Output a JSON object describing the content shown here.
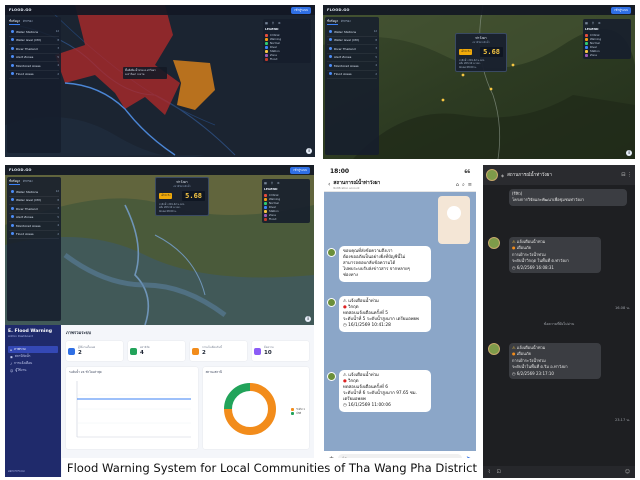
{
  "caption": "Flood Warning System for Local Communities of Tha Wang Pha District",
  "map": {
    "logo": "FLOOD.GO",
    "button": "เข้าสู่ระบบ",
    "tabs": [
      "ชั้นข้อมูล",
      "ตัวกรอง"
    ],
    "layers": [
      {
        "label": "Water Stations",
        "count": "12"
      },
      {
        "label": "Water level (CM)",
        "count": "8"
      },
      {
        "label": "River Thailand",
        "count": "3"
      },
      {
        "label": "Alert Zones",
        "count": "5"
      },
      {
        "label": "Monitored Areas",
        "count": "4"
      },
      {
        "label": "Flood Areas",
        "count": "2"
      }
    ],
    "legend_title": "LEGEND",
    "legend": [
      {
        "label": "Critical",
        "color": "#e74c3c"
      },
      {
        "label": "Warning",
        "color": "#f39c12"
      },
      {
        "label": "Normal",
        "color": "#2ecc71"
      },
      {
        "label": "River",
        "color": "#3b82f6"
      },
      {
        "label": "Station",
        "color": "#f5c542"
      },
      {
        "label": "Zone",
        "color": "#9b59b6"
      },
      {
        "label": "Flood",
        "color": "#c0392b"
      }
    ],
    "map1_popup": "พื้นที่เสี่ยงน้ำท่วม ต.ท่าวังผา อ.ท่าวังผา จ.น่าน",
    "card": {
      "title": "ท่าวังผา",
      "subtitle": "สถานีวัดระดับน้ำ",
      "badge": "เฝ้าระวัง",
      "value": "5.68",
      "lines": [
        "ระดับน้ำ 201.42 ม.รทก.",
        "ตลิ่ง 203.10 ม.รทก.",
        "อัปเดต 08:00 น."
      ]
    }
  },
  "dashboard": {
    "title": "E. Flood Warning",
    "subtitle": "Admin Dashboard",
    "nav": [
      "ภาพรวม",
      "สถานีวัดน้ำ",
      "การแจ้งเตือน",
      "ผู้ใช้งาน"
    ],
    "footer": "ออกจากระบบ",
    "heading": "ภาพรวมระบบ",
    "stats": [
      {
        "label": "ผู้ใช้งานทั้งหมด",
        "value": "2",
        "color": "#2f6fe4"
      },
      {
        "label": "สถานีวัด",
        "value": "4",
        "color": "#22a35a"
      },
      {
        "label": "การแจ้งเตือนวันนี้",
        "value": "2",
        "color": "#f28c1b"
      },
      {
        "label": "ข้อความ",
        "value": "10",
        "color": "#8b5cf6"
      }
    ],
    "line_chart_title": "ระดับน้ำ 24 ชั่วโมงล่าสุด",
    "donut_title": "สถานะสถานี",
    "donut_legend": [
      {
        "label": "ระดับ 1",
        "color": "#f28c1b",
        "value": 3
      },
      {
        "label": "ปกติ",
        "color": "#22a35a",
        "value": 1
      }
    ]
  },
  "chat_light": {
    "time": "18:00",
    "battery": "66",
    "name": "สถานการณ์น้ำท่าวังผา",
    "subname": "Notification account",
    "msg1": [
      "ขอบคุณที่ส่งข้อความถึงเรา",
      "ต้องขออภัยเป็นอย่างยิ่งที่บัญชีนี้ไม่",
      "สามารถตอบกลับข้อความได้",
      "ไปพบระบบรับส่งข่าวสาร จากหลายๆ",
      "ช่องทาง"
    ],
    "msg2": [
      "แจ้งเตือนน้ำท่วม",
      "วิกฤต",
      "ทดสอบแจ้งเตือนครั้งที่ 5",
      "ระดับน้ำที่ 5 ระดับน้ำสูงมาก เตรียมอพยพ"
    ],
    "msg2_time": "16/1/2569 10:41:28",
    "msg3": [
      "แจ้งเตือนน้ำท่วม",
      "วิกฤต",
      "ทดสอบแจ้งเตือนครั้งที่ 6",
      "ระดับน้ำที่ 6 ระดับน้ำสูงมาก 97.65 ซม. เตรียมอพยพ"
    ],
    "msg3_time": "16/1/2569 11:00:06",
    "input_placeholder": "Aa"
  },
  "chat_dark": {
    "name": "สถานการณ์น้ำท่าวังผา",
    "msg0": [
      "(รีฟิว)",
      "โครงการวิจัยและพัฒนาเพื่อชุมชนท่าวังผา"
    ],
    "msg1": [
      "แจ้งเตือนน้ำท่วม",
      "เตือนภัย",
      "การเฝ้าระวังน้ำท่วม",
      "ระดับน้ำวิกฤต ในพื้นที่ ต.ท่าวังผา",
      "6/2/2569 16:08:31"
    ],
    "sep": "ข้อความที่ยังไม่อ่าน",
    "msg2": [
      "แจ้งเตือนน้ำท่วม",
      "เตือนภัย",
      "การเฝ้าระวังน้ำท่วม",
      "ระดับน้ำในพื้นที่ ต.ริม อ.ท่าวังผา",
      "6/2/2569 23:17:10"
    ],
    "time1": "16.08 น.",
    "time2": "23.17 น."
  }
}
